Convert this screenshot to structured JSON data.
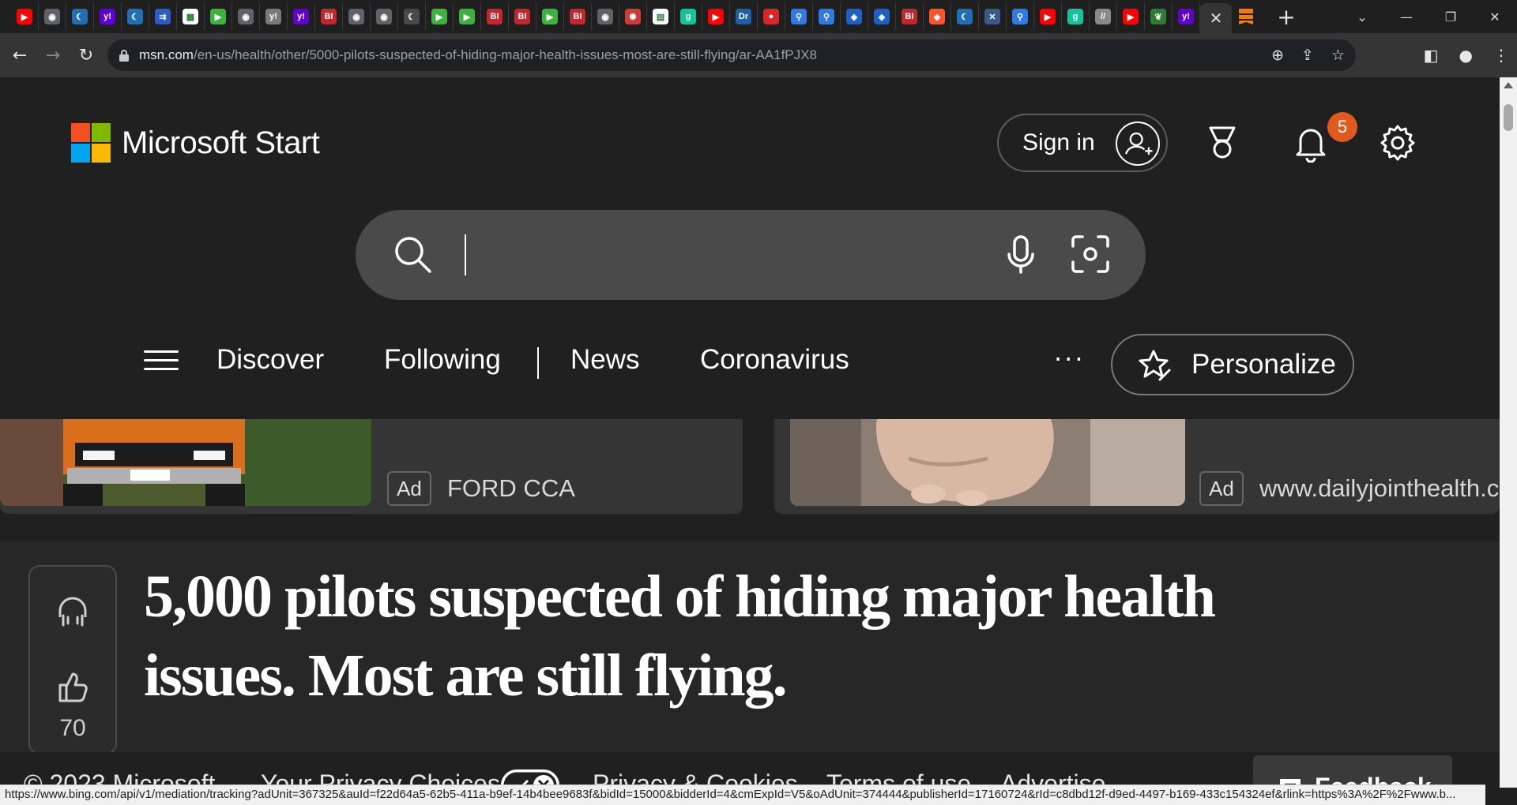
{
  "browser": {
    "tabs": [
      {
        "icon": "youtube-icon",
        "color": "#ff0000",
        "glyph": "▶"
      },
      {
        "icon": "globe-icon",
        "color": "#5f6368",
        "glyph": "◉"
      },
      {
        "icon": "shield-icon",
        "color": "#1f6fb2",
        "glyph": "☾"
      },
      {
        "icon": "yahoo-icon",
        "color": "#6001d2",
        "glyph": "y!"
      },
      {
        "icon": "shield-icon",
        "color": "#1f6fb2",
        "glyph": "☾"
      },
      {
        "icon": "arrow-icon",
        "color": "#2c5cc5",
        "glyph": "⇉"
      },
      {
        "icon": "sheets-icon",
        "color": "#ffffff",
        "glyph": "▦"
      },
      {
        "icon": "play-icon",
        "color": "#3eb23e",
        "glyph": "▶"
      },
      {
        "icon": "globe-icon",
        "color": "#5f6368",
        "glyph": "◉"
      },
      {
        "icon": "yahoo-finance-icon",
        "color": "#7a7a7a",
        "glyph": "y!"
      },
      {
        "icon": "yahoo-icon",
        "color": "#6001d2",
        "glyph": "y!"
      },
      {
        "icon": "business-insider-icon",
        "color": "#c1272d",
        "glyph": "BI"
      },
      {
        "icon": "globe-icon",
        "color": "#5f6368",
        "glyph": "◉"
      },
      {
        "icon": "globe-icon",
        "color": "#5f6368",
        "glyph": "◉"
      },
      {
        "icon": "shield-icon",
        "color": "#4a4a4a",
        "glyph": "☾"
      },
      {
        "icon": "play-icon",
        "color": "#3eb23e",
        "glyph": "▶"
      },
      {
        "icon": "play-icon",
        "color": "#3eb23e",
        "glyph": "▶"
      },
      {
        "icon": "business-insider-icon",
        "color": "#c1272d",
        "glyph": "BI"
      },
      {
        "icon": "business-insider-icon",
        "color": "#c1272d",
        "glyph": "BI"
      },
      {
        "icon": "play-icon",
        "color": "#3eb23e",
        "glyph": "▶"
      },
      {
        "icon": "business-insider-icon",
        "color": "#c1272d",
        "glyph": "BI"
      },
      {
        "icon": "globe-icon",
        "color": "#5f6368",
        "glyph": "◉"
      },
      {
        "icon": "burst-icon",
        "color": "#d23a3a",
        "glyph": "✺"
      },
      {
        "icon": "news-icon",
        "color": "#ffffff",
        "glyph": "▤"
      },
      {
        "icon": "grammarly-icon",
        "color": "#15c39a",
        "glyph": "g"
      },
      {
        "icon": "youtube-icon",
        "color": "#ff0000",
        "glyph": "▶"
      },
      {
        "icon": "dr-icon",
        "color": "#1f5fa8",
        "glyph": "Dr"
      },
      {
        "icon": "mic-red-icon",
        "color": "#d8262a",
        "glyph": "●"
      },
      {
        "icon": "search-icon",
        "color": "#2f7ae5",
        "glyph": "⚲"
      },
      {
        "icon": "search-icon",
        "color": "#2f7ae5",
        "glyph": "⚲"
      },
      {
        "icon": "cube-icon",
        "color": "#1d5fc4",
        "glyph": "◈"
      },
      {
        "icon": "cube-icon",
        "color": "#1d5fc4",
        "glyph": "◈"
      },
      {
        "icon": "business-insider-icon",
        "color": "#c1272d",
        "glyph": "BI"
      },
      {
        "icon": "brave-icon",
        "color": "#fb542b",
        "glyph": "◆"
      },
      {
        "icon": "shield-icon",
        "color": "#1f6fb2",
        "glyph": "☾"
      },
      {
        "icon": "crest-icon",
        "color": "#3a5a8c",
        "glyph": "✕"
      },
      {
        "icon": "search-icon",
        "color": "#2f7ae5",
        "glyph": "⚲"
      },
      {
        "icon": "youtube-icon",
        "color": "#ff0000",
        "glyph": "▶"
      },
      {
        "icon": "grammarly-icon",
        "color": "#15c39a",
        "glyph": "g"
      },
      {
        "icon": "italic-icon",
        "color": "#8a8a8a",
        "glyph": "//"
      },
      {
        "icon": "youtube-icon",
        "color": "#ff0000",
        "glyph": "▶"
      },
      {
        "icon": "leaf-icon",
        "color": "#2e7d32",
        "glyph": "❦"
      },
      {
        "icon": "yahoo-icon",
        "color": "#6001d2",
        "glyph": "y!"
      }
    ],
    "active_tab_close": "✕",
    "next_tab_icon": "bookmark-orange-icon",
    "new_tab_label": "+",
    "url_host": "msn.com",
    "url_path": "/en-us/health/other/5000-pilots-suspected-of-hiding-major-health-issues-most-are-still-flying/ar-AA1fPJX8",
    "status_url": "https://www.bing.com/api/v1/mediation/tracking?adUnit=367325&auId=f22d64a5-62b5-411a-b9ef-14b4bee9683f&bidId=15000&bidderId=4&cmExpId=V5&oAdUnit=374444&publisherId=17160724&rId=c8dbd12f-d9ed-4497-b169-433c154324ef&rlink=https%3A%2F%2Fwww.b..."
  },
  "header": {
    "brand": "Microsoft Start",
    "brand_colors": [
      "#f25022",
      "#7fba00",
      "#00a4ef",
      "#ffb900"
    ],
    "sign_in_label": "Sign in",
    "notification_count": "5",
    "badge_color": "#e05a1e"
  },
  "search": {
    "value": "",
    "placeholder": ""
  },
  "nav": {
    "items": [
      "Discover",
      "Following",
      "News",
      "Coronavirus"
    ],
    "more_label": "···",
    "personalize_label": "Personalize"
  },
  "ads": [
    {
      "tag": "Ad",
      "source": "FORD CCA"
    },
    {
      "tag": "Ad",
      "source": "www.dailyjointhealth.com"
    }
  ],
  "article": {
    "headline": "5,000 pilots suspected of hiding major health issues. Most are still flying.",
    "likes": "70"
  },
  "footer": {
    "copyright": "© 2023 Microsoft",
    "privacy_choices": "Your Privacy Choices",
    "privacy_cookies": "Privacy & Cookies",
    "terms": "Terms of use",
    "advertise": "Advertise",
    "feedback": "Feedback"
  }
}
